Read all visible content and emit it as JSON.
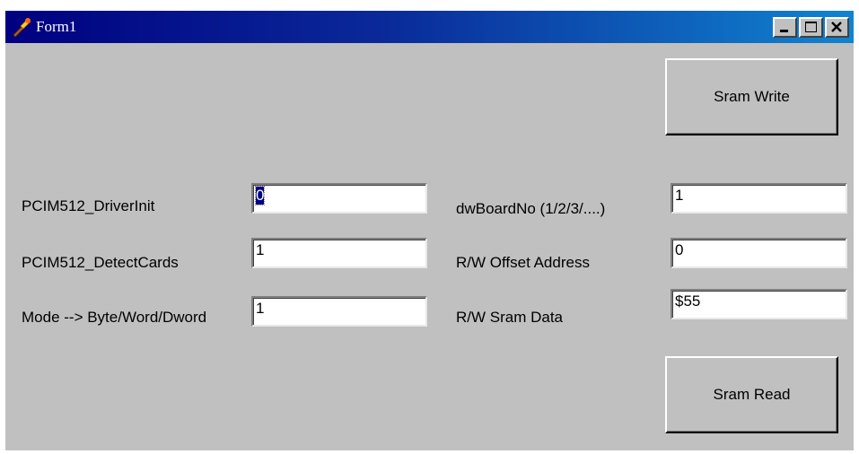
{
  "window": {
    "title": "Form1",
    "controls": {
      "minimize_icon": "minimize-icon",
      "maximize_icon": "maximize-icon",
      "close_icon": "close-icon"
    },
    "titlebar_color": "#000080",
    "face_color": "#c0c0c0"
  },
  "buttons": {
    "sram_write": "Sram Write",
    "sram_read": "Sram Read"
  },
  "left_fields": [
    {
      "label": "PCIM512_DriverInit",
      "value": "0",
      "selected": true
    },
    {
      "label": "PCIM512_DetectCards",
      "value": "1"
    },
    {
      "label": "Mode --> Byte/Word/Dword",
      "value": "1"
    }
  ],
  "right_fields": [
    {
      "label": "dwBoardNo  (1/2/3/....)",
      "value": "1"
    },
    {
      "label": "R/W Offset Address",
      "value": "0"
    },
    {
      "label": "R/W  Sram Data",
      "value": "$55"
    }
  ]
}
